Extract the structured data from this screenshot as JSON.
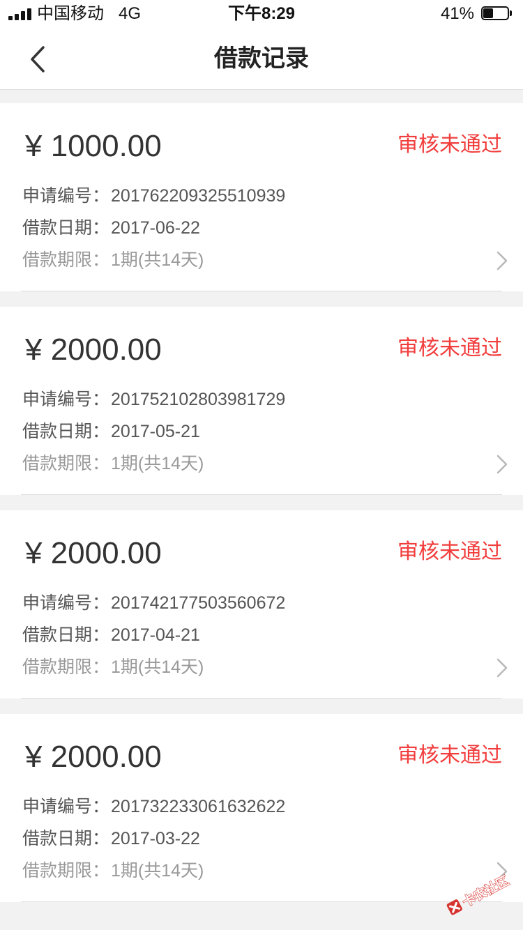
{
  "status_bar": {
    "carrier": "中国移动",
    "network": "4G",
    "time": "下午8:29",
    "battery": "41%",
    "battery_level": 0.41
  },
  "nav": {
    "back_icon": "chevron-left-icon",
    "title": "借款记录"
  },
  "records": [
    {
      "amount": "¥ 1000.00",
      "status": "审核未通过",
      "id_label": "申请编号：",
      "id": "201762209325510939",
      "date_label": "借款日期：",
      "date": "2017-06-22",
      "term_label": "借款期限：",
      "term": "1期(共14天)"
    },
    {
      "amount": "¥ 2000.00",
      "status": "审核未通过",
      "id_label": "申请编号：",
      "id": "201752102803981729",
      "date_label": "借款日期：",
      "date": "2017-05-21",
      "term_label": "借款期限：",
      "term": "1期(共14天)"
    },
    {
      "amount": "¥ 2000.00",
      "status": "审核未通过",
      "id_label": "申请编号：",
      "id": "201742177503560672",
      "date_label": "借款日期：",
      "date": "2017-04-21",
      "term_label": "借款期限：",
      "term": "1期(共14天)"
    },
    {
      "amount": "¥ 2000.00",
      "status": "审核未通过",
      "id_label": "申请编号：",
      "id": "201732233061632622",
      "date_label": "借款日期：",
      "date": "2017-03-22",
      "term_label": "借款期限：",
      "term": "1期(共14天)"
    }
  ],
  "colors": {
    "status_red": "#f23d3d",
    "background": "#f2f2f2",
    "card": "#ffffff"
  },
  "watermark": {
    "text": "卡农社区"
  }
}
